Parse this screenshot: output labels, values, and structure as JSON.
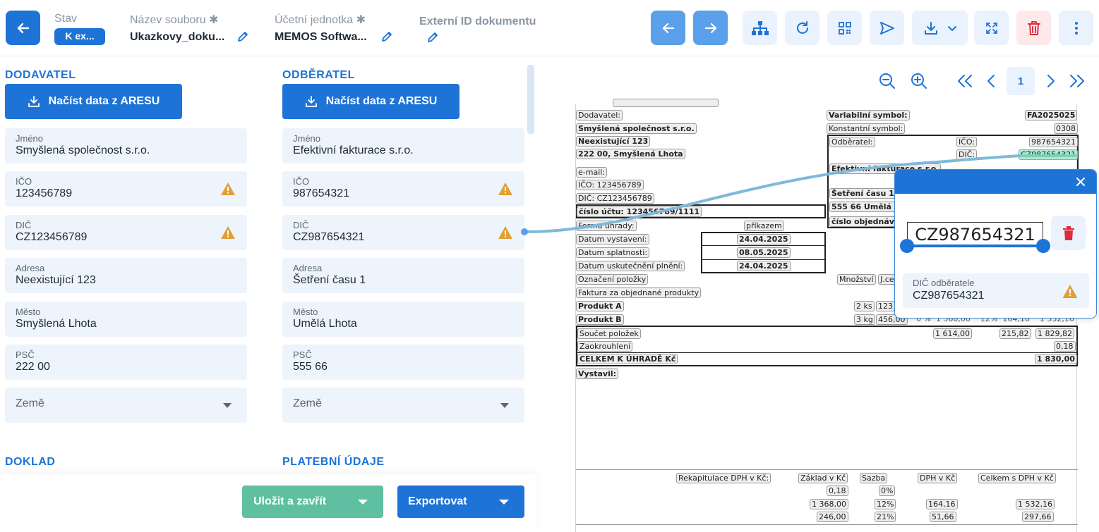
{
  "header": {
    "status_label": "Stav",
    "status_value": "K ex...",
    "filename_label": "Název souboru",
    "filename_value": "Ukazkovy_doku...",
    "unit_label": "Účetní jednotka",
    "unit_value": "MEMOS Softwa...",
    "external_id_label": "Externí ID dokumentu",
    "required_mark": "✱",
    "colors": {
      "primary": "#1e73d6",
      "danger": "#e02a3a",
      "success": "#5ec0a0",
      "field_bg": "#edf4fc"
    },
    "toolbar_icons": [
      "arrow-left-icon",
      "arrow-right-icon",
      "hierarchy-icon",
      "refresh-icon",
      "qr-code-icon",
      "send-icon",
      "download-icon",
      "chevron-down-icon",
      "expand-icon",
      "trash-icon",
      "more-vertical-icon"
    ]
  },
  "supplier": {
    "title": "DODAVATEL",
    "ares_button": "Načíst data z ARESU",
    "fields": [
      {
        "label": "Jméno",
        "value": "Smyšlená společnost s.r.o."
      },
      {
        "label": "IČO",
        "value": "123456789"
      },
      {
        "label": "DIČ",
        "value": "CZ123456789"
      },
      {
        "label": "Adresa",
        "value": "Neexistující 123"
      },
      {
        "label": "Město",
        "value": "Smyšlená Lhota"
      },
      {
        "label": "PSČ",
        "value": "222 00"
      }
    ],
    "country_placeholder": "Země"
  },
  "customer": {
    "title": "ODBĚRATEL",
    "ares_button": "Načíst data z ARESU",
    "fields": [
      {
        "label": "Jméno",
        "value": "Efektivní fakturace s.r.o."
      },
      {
        "label": "IČO",
        "value": "987654321"
      },
      {
        "label": "DIČ",
        "value": "CZ987654321"
      },
      {
        "label": "Adresa",
        "value": "Šetření času 1"
      },
      {
        "label": "Město",
        "value": "Umělá Lhota"
      },
      {
        "label": "PSČ",
        "value": "555 66"
      }
    ],
    "country_placeholder": "Země"
  },
  "sections": {
    "document": "DOKLAD",
    "payment": "PLATEBNÍ ÚDAJE"
  },
  "actions": {
    "save_close": "Uložit a zavřít",
    "export": "Exportovat"
  },
  "viewer": {
    "page": "1"
  },
  "popover": {
    "input_value": "CZ987654321",
    "field_label": "DIČ odběratele",
    "field_value": "CZ987654321"
  },
  "invoice": {
    "supplier_label": "Dodavatel:",
    "supplier_name": "Smyšlená společnost s.r.o.",
    "supplier_street": "Neexistující 123",
    "supplier_city": "222 00, Smyšlená Lhota",
    "email": "e-mail:",
    "ico": "IČO: 123456789",
    "dic": "DIČ: CZ123456789",
    "account": "číslo účtu: 123456789/1111",
    "vs_label": "Variabilní symbol:",
    "vs_value": "FA2025025",
    "ks_label": "Konstantní symbol:",
    "ks_value": "0308",
    "customer_label": "Odběratel:",
    "cust_ico_label": "IČO:",
    "cust_ico_value": "987654321",
    "cust_dic_label": "DIČ:",
    "cust_dic_value": "CZ987654321",
    "cust_name": "Efektivní fakturace s.r.o.",
    "cust_street": "Šetření času 1",
    "cust_city": "555 66 Umělá L",
    "order_no": "číslo objednávk",
    "payment_label": "Forma úhrady:",
    "payment_value": "příkazem",
    "issued_label": "Datum vystavení:",
    "issued_value": "24.04.2025",
    "due_label": "Datum splatnosti:",
    "due_value": "08.05.2025",
    "taxdate_label": "Datum uskutečnění plnění:",
    "taxdate_value": "24.04.2025",
    "items_label": "Označení položky",
    "qty_label": "Množství",
    "qty_label2": "J.ce",
    "items_note": "Faktura za objednané produkty",
    "prod_a": "Produkt A",
    "prod_a_qty": "2 ks",
    "prod_a_price": "123",
    "prod_b": "Produkt B",
    "prod_b_qty": "3 kg",
    "prod_b_price": "456,00",
    "prod_b_rest": "0 %  1 368,00    12%  164,16    1 532,16",
    "sum_label": "Součet položek",
    "sum_base": "1 614,00",
    "sum_vat": "215,82",
    "sum_total": "1 829,82",
    "rounding_label": "Zaokrouhlení",
    "rounding_value": "0,18",
    "total_label": "CELKEM K ÚHRADĚ Kč",
    "total_value": "1 830,00",
    "issued_by": "Vystavil:",
    "recap_label": "Rekapitulace DPH v Kč:",
    "base_label": "Základ v Kč",
    "rate_label": "Sazba",
    "vat_label": "DPH v Kč",
    "withvat_label": "Celkem s DPH v Kč",
    "r1_base": "0,18",
    "r1_rate": "0%",
    "r2_base": "1 368,00",
    "r2_rate": "12%",
    "r2_vat": "164,16",
    "r2_total": "1 532,16",
    "r3_base": "246,00",
    "r3_rate": "21%",
    "r3_vat": "51,66",
    "r3_total": "297,66"
  }
}
